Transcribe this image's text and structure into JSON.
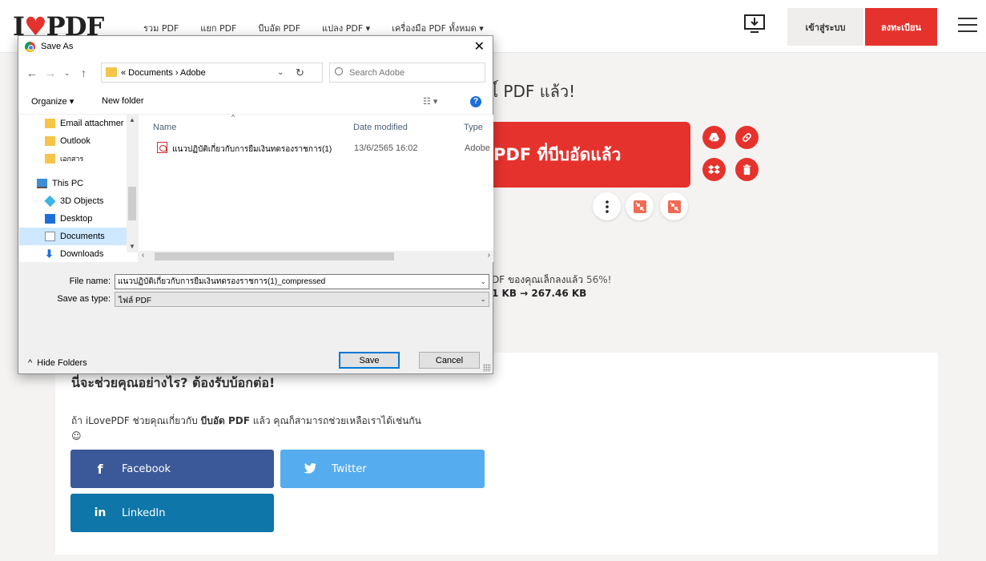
{
  "nav": {
    "logo_text": "I",
    "logo_text2": "PDF",
    "links": [
      "รวม PDF",
      "แยก PDF",
      "บีบอัด PDF",
      "แปลง PDF ▾",
      "เครื่องมือ PDF ทั้งหมด ▾"
    ],
    "login": "เข้าสู่ระบบ",
    "signup": "ลงทะเบียน",
    "accent_color": "#e5322d"
  },
  "main": {
    "headline": "ไ์ PDF แล้ว!",
    "download_label": "PDF ที่บีบอัดแล้ว",
    "result_text": "DF ของคุณเล็กลงแล้ว",
    "result_percent": "56%!",
    "result_size": "1 KB → 267.46 KB",
    "side_icons": [
      "google-drive-icon",
      "link-icon",
      "dropbox-icon",
      "trash-icon"
    ],
    "small_icons": [
      "more-icon",
      "compress-icon",
      "compress-icon"
    ]
  },
  "share": {
    "title": "นี่จะช่วยคุณอย่างไร? ต้องรับบ้อกต่อ!",
    "text_pre": "ถ้า iLovePDF ช่วยคุณเกี่ยวกับ",
    "text_bold": "บีบอัด PDF",
    "text_post": "แล้ว คุณก็สามารถช่วยเหลือเราได้เช่นกัน",
    "smiley": "☺",
    "facebook": "Facebook",
    "twitter": "Twitter",
    "linkedin": "LinkedIn"
  },
  "dialog": {
    "title": "Save As",
    "path": "« Documents › Adobe",
    "search_placeholder": "Search Adobe",
    "organize": "Organize ▾",
    "new_folder": "New folder",
    "nav_items": [
      {
        "label": "Email attachmer",
        "icon": "folder-icon"
      },
      {
        "label": "Outlook",
        "icon": "folder-icon"
      },
      {
        "label": "เอกสาร",
        "icon": "folder-icon"
      },
      {
        "label": "This PC",
        "icon": "computer-icon"
      },
      {
        "label": "3D Objects",
        "icon": "cube-icon"
      },
      {
        "label": "Desktop",
        "icon": "desktop-icon"
      },
      {
        "label": "Documents",
        "icon": "documents-icon"
      },
      {
        "label": "Downloads",
        "icon": "download-icon"
      }
    ],
    "columns": {
      "name": "Name",
      "date": "Date modified",
      "type": "Type"
    },
    "files": [
      {
        "name": "แนวปฏิบัติเกี่ยวกับการยืมเงินทดรองราชการ(1)",
        "date": "13/6/2565 16:02",
        "type": "Adobe"
      }
    ],
    "file_name_label": "File name:",
    "file_name_value": "แนวปฏิบัติเกี่ยวกับการยืมเงินทดรองราชการ(1)_compressed",
    "save_type_label": "Save as type:",
    "save_type_value": "ไฟล์ PDF",
    "hide_folders": "Hide Folders",
    "save": "Save",
    "cancel": "Cancel"
  }
}
